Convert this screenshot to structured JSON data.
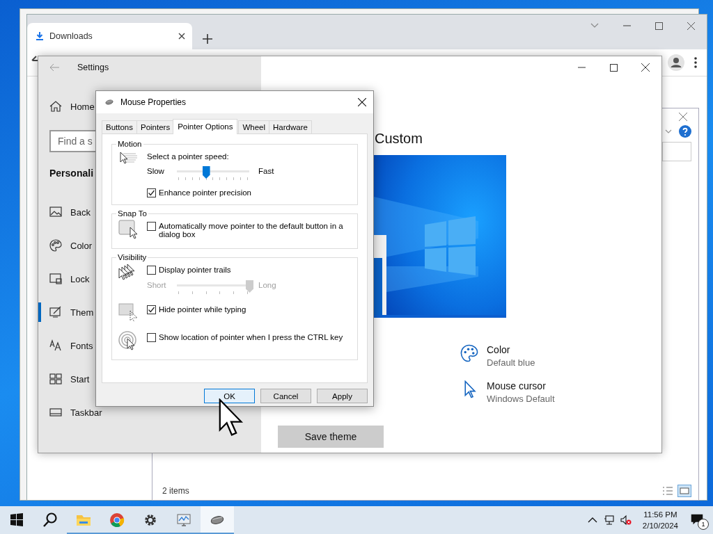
{
  "browser": {
    "tab": {
      "label": "Downloads"
    },
    "status": "2 items"
  },
  "settings": {
    "title": "Settings",
    "home": "Home",
    "search": {
      "placeholder": "Find a s"
    },
    "section": "Personali",
    "nav": [
      {
        "label": "Back",
        "selected": false
      },
      {
        "label": "Color",
        "selected": false
      },
      {
        "label": "Lock",
        "selected": false
      },
      {
        "label": "Them",
        "selected": true
      },
      {
        "label": "Fonts",
        "selected": false
      },
      {
        "label": "Start",
        "selected": false
      },
      {
        "label": "Taskbar",
        "selected": false
      }
    ],
    "theme": {
      "heading": "Custom",
      "details": [
        {
          "label": "Color",
          "value": "Default blue"
        },
        {
          "label": "Mouse cursor",
          "value": "Windows Default"
        }
      ],
      "save": "Save theme"
    }
  },
  "dialog": {
    "title": "Mouse Properties",
    "tabs": [
      {
        "label": "Buttons",
        "selected": false
      },
      {
        "label": "Pointers",
        "selected": false
      },
      {
        "label": "Pointer Options",
        "selected": true
      },
      {
        "label": "Wheel",
        "selected": false
      },
      {
        "label": "Hardware",
        "selected": false
      }
    ],
    "groups": [
      {
        "title": "Motion",
        "rows": [
          {
            "items": [
              {
                "kind": "label",
                "text": "Select a pointer speed:"
              },
              {
                "kind": "slider",
                "min_label": "Slow",
                "max_label": "Fast",
                "level": 0.4,
                "disabled": false
              },
              {
                "kind": "checkbox",
                "label": "Enhance pointer precision",
                "checked": true
              }
            ]
          }
        ]
      },
      {
        "title": "Snap To",
        "rows": [
          {
            "items": [
              {
                "kind": "checkbox",
                "label": "Automatically move pointer to the default button in a dialog box",
                "checked": false
              }
            ]
          }
        ]
      },
      {
        "title": "Visibility",
        "rows": [
          {
            "items": [
              {
                "kind": "checkbox",
                "label": "Display pointer trails",
                "checked": false
              },
              {
                "kind": "slider",
                "min_label": "Short",
                "max_label": "Long",
                "level": 1,
                "disabled": true
              }
            ]
          },
          {
            "items": [
              {
                "kind": "checkbox",
                "label": "Hide pointer while typing",
                "checked": true
              }
            ]
          },
          {
            "items": [
              {
                "kind": "checkbox",
                "label": "Show location of pointer when I press the CTRL key",
                "checked": false
              }
            ]
          }
        ]
      }
    ],
    "buttons": [
      {
        "label": "OK",
        "default": true
      },
      {
        "label": "Cancel",
        "default": false
      },
      {
        "label": "Apply",
        "default": false
      }
    ]
  },
  "taskbar": {
    "apps": [
      {
        "running": true,
        "selected": false
      },
      {
        "running": true,
        "selected": false
      },
      {
        "running": true,
        "selected": false
      },
      {
        "running": true,
        "selected": false
      },
      {
        "running": true,
        "selected": true
      }
    ],
    "time": "11:56 PM",
    "date": "2/10/2024",
    "notifications": "1"
  }
}
